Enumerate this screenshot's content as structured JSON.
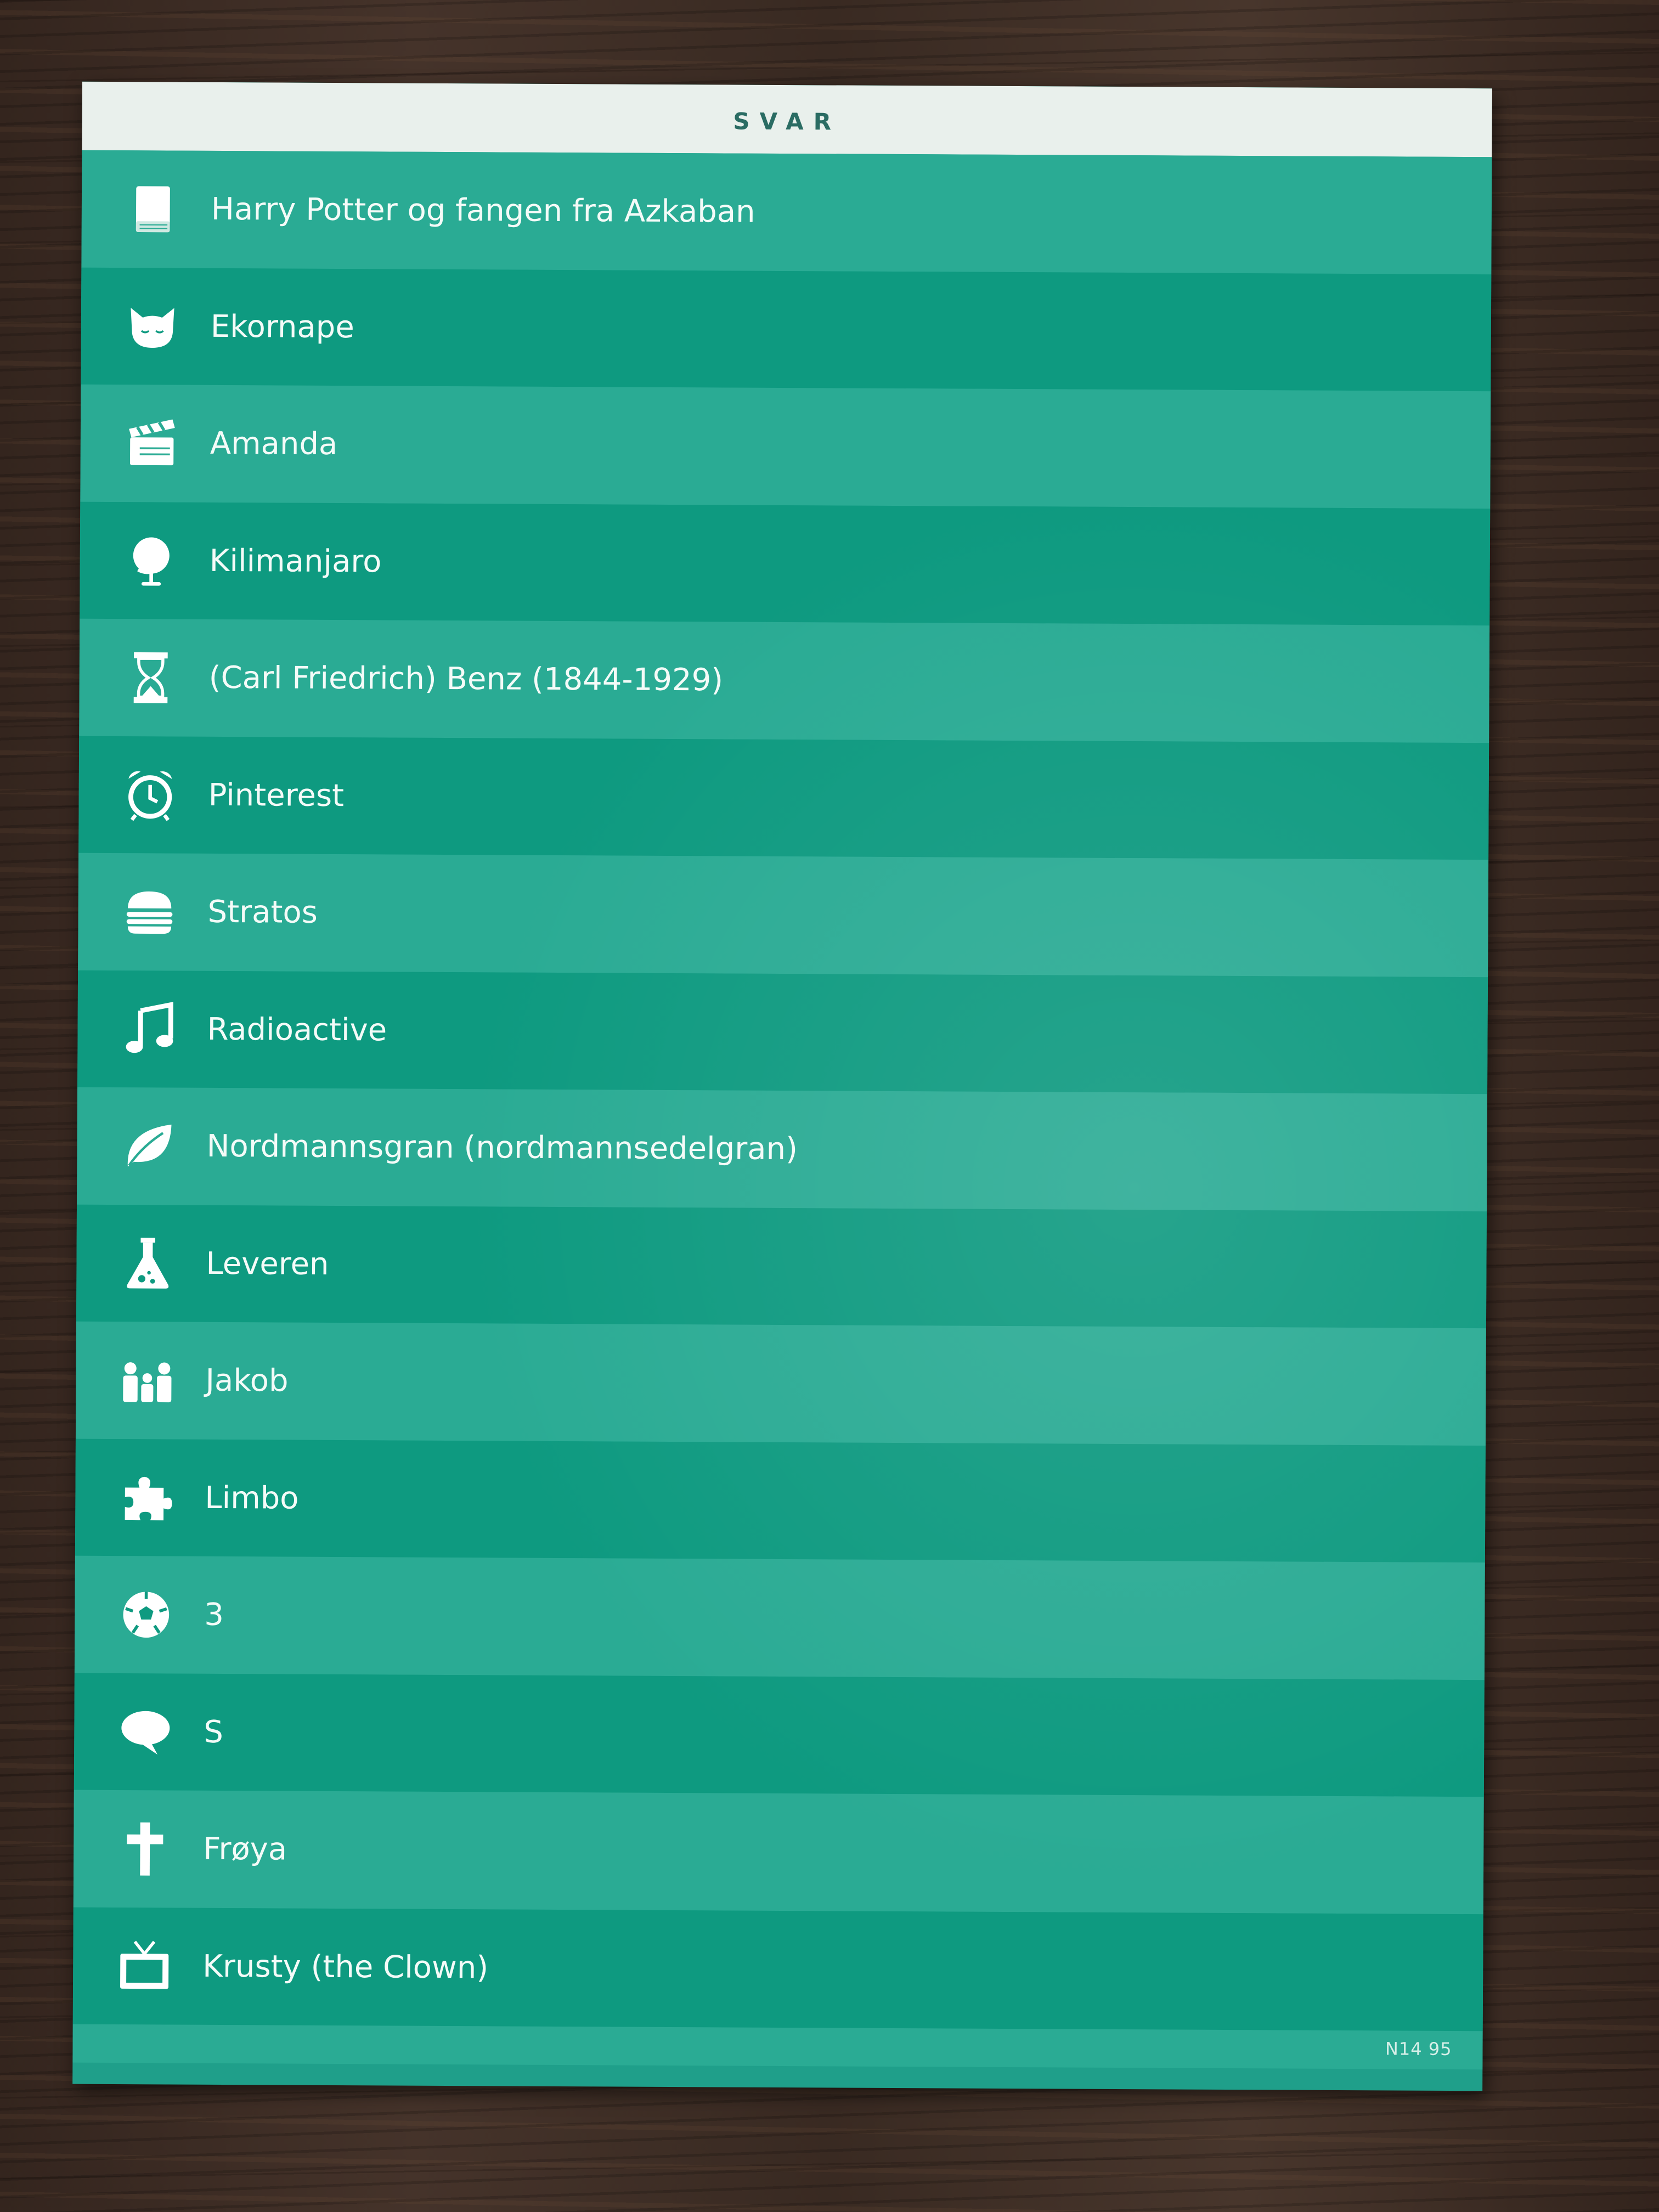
{
  "card": {
    "header_title": "SVAR",
    "code": "N14 95",
    "colors": {
      "header_bg": "#e9f0ec",
      "header_text": "#2a6c63",
      "row_light": "#2aab94",
      "row_dark": "#0e9a80",
      "text": "#f4fbf8"
    },
    "answers": [
      {
        "icon": "book-icon",
        "label": "Harry Potter og fangen fra Azkaban"
      },
      {
        "icon": "cat-icon",
        "label": "Ekornape"
      },
      {
        "icon": "clapperboard-icon",
        "label": "Amanda"
      },
      {
        "icon": "globe-icon",
        "label": "Kilimanjaro"
      },
      {
        "icon": "hourglass-icon",
        "label": "(Carl Friedrich) Benz (1844-1929)"
      },
      {
        "icon": "alarm-clock-icon",
        "label": "Pinterest"
      },
      {
        "icon": "burger-icon",
        "label": "Stratos"
      },
      {
        "icon": "music-note-icon",
        "label": "Radioactive"
      },
      {
        "icon": "leaf-icon",
        "label": "Nordmannsgran (nordmannsedelgran)"
      },
      {
        "icon": "flask-icon",
        "label": "Leveren"
      },
      {
        "icon": "family-icon",
        "label": "Jakob"
      },
      {
        "icon": "puzzle-icon",
        "label": "Limbo"
      },
      {
        "icon": "soccer-ball-icon",
        "label": "3"
      },
      {
        "icon": "speech-bubble-icon",
        "label": "S"
      },
      {
        "icon": "cross-icon",
        "label": "Frøya"
      },
      {
        "icon": "tv-icon",
        "label": "Krusty (the Clown)"
      }
    ]
  }
}
